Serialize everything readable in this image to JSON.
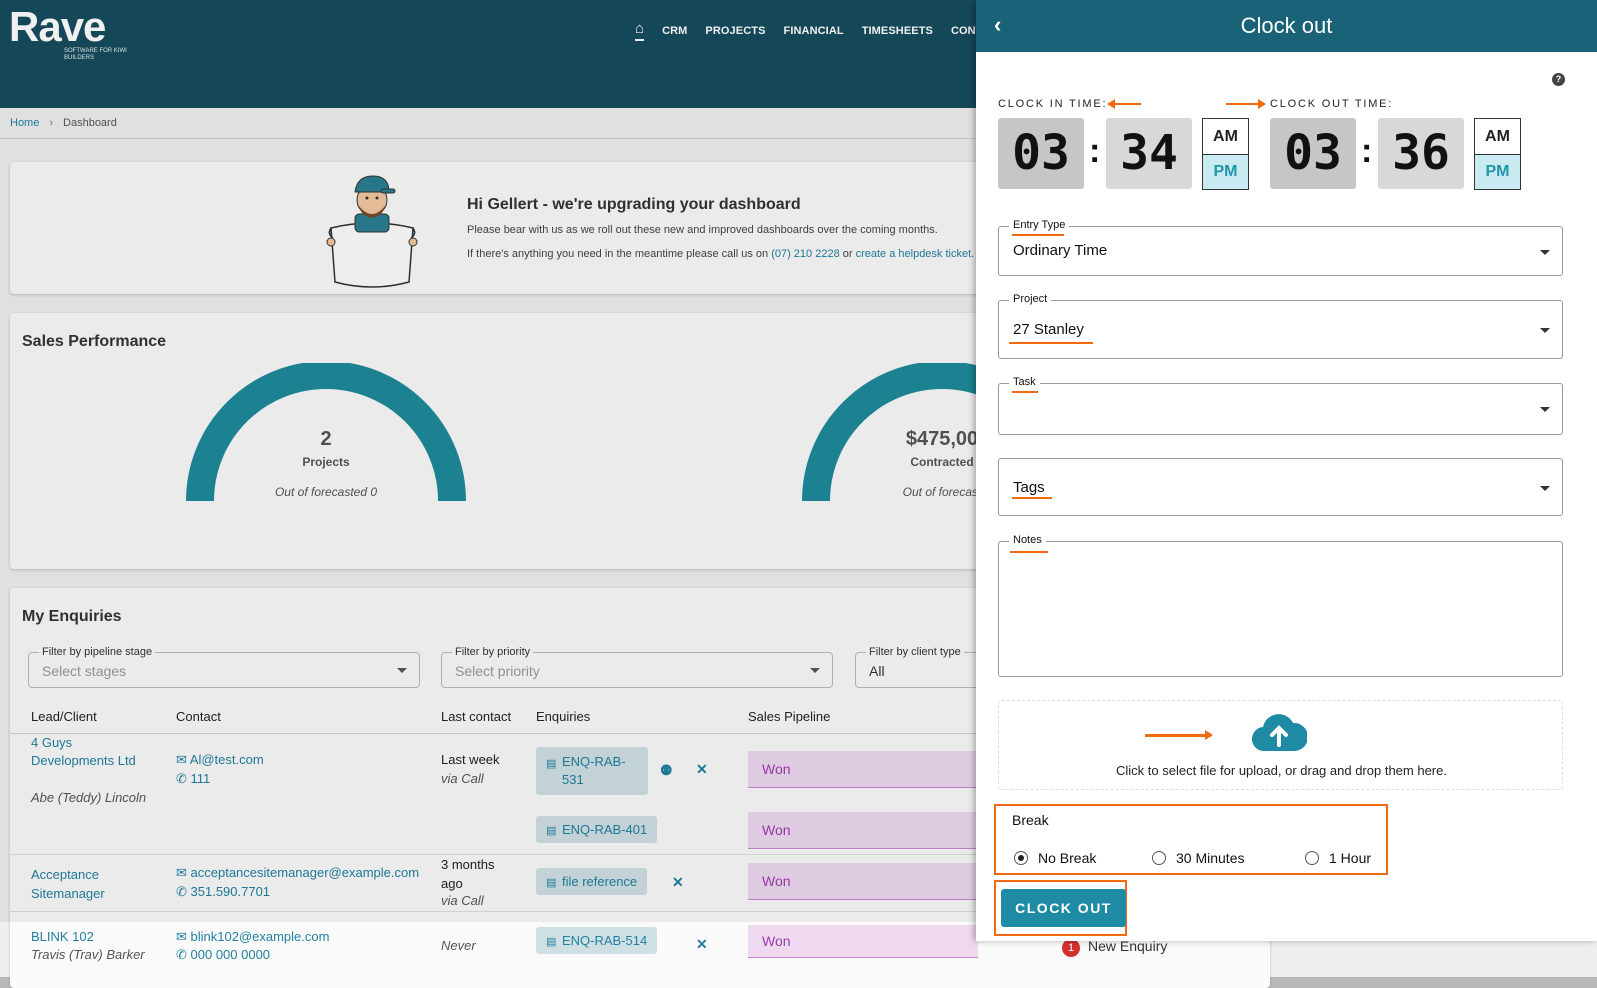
{
  "app": {
    "logo_main": "Rave",
    "logo_sub": "SOFTWARE FOR KIWI BUILDERS",
    "nav": [
      "CRM",
      "PROJECTS",
      "FINANCIAL",
      "TIMESHEETS",
      "CONT"
    ],
    "breadcrumb": {
      "home": "Home",
      "current": "Dashboard"
    },
    "welcome": {
      "title": "Hi Gellert - we're upgrading your dashboard",
      "line1": "Please bear with us as we roll out these new and improved dashboards over the coming months.",
      "line2_prefix": "If there's anything you need in the meantime please call us on",
      "phone": "(07) 210 2228",
      "or": "or",
      "ticket": "create a helpdesk ticket."
    },
    "sales": {
      "title": "Sales Performance",
      "gauge1": {
        "value": "2",
        "label": "Projects",
        "sub": "Out of forecasted 0"
      },
      "gauge2": {
        "value": "$475,00",
        "label": "Contracted",
        "sub": "Out of forecast"
      },
      "accent": "#1e8a9a"
    },
    "enquiries": {
      "title": "My Enquiries",
      "filters": [
        {
          "label": "Filter by pipeline stage",
          "placeholder": "Select stages"
        },
        {
          "label": "Filter by priority",
          "placeholder": "Select priority"
        },
        {
          "label": "Filter by client type",
          "value": "All"
        }
      ],
      "headers": [
        "Lead/Client",
        "Contact",
        "Last contact",
        "Enquiries",
        "Sales Pipeline"
      ],
      "rows": [
        {
          "lead": "4 Guys Developments Ltd",
          "person": "Abe (Teddy) Lincoln",
          "email": "Al@test.com",
          "phone": "111",
          "last": "Last week",
          "via": "via Call",
          "enq1": "ENQ-RAB-531",
          "enq2": "ENQ-RAB-401",
          "stage1": "Won",
          "stage2": "Won"
        },
        {
          "lead": "Acceptance Sitemanager",
          "email": "acceptancesitemanager@example.com",
          "phone": "351.590.7701",
          "last": "3 months ago",
          "via": "via Call",
          "enq1": "file reference",
          "stage1": "Won"
        },
        {
          "lead": "BLINK 102",
          "person": "Travis (Trav) Barker",
          "email": "blink102@example.com",
          "phone": "000 000 0000",
          "last": "Never",
          "enq1": "ENQ-RAB-514",
          "stage1": "Won",
          "status_count": "1",
          "status": "New Enquiry"
        }
      ]
    }
  },
  "drawer": {
    "title": "Clock out",
    "clock_in_label": "CLOCK IN TIME:",
    "clock_out_label": "CLOCK OUT TIME:",
    "clock_in": {
      "hour": "03",
      "minute": "34",
      "am": "AM",
      "pm": "PM",
      "selected": "PM"
    },
    "clock_out": {
      "hour": "03",
      "minute": "36",
      "am": "AM",
      "pm": "PM",
      "selected": "PM"
    },
    "entry_type": {
      "label": "Entry Type",
      "value": "Ordinary Time"
    },
    "project": {
      "label": "Project",
      "value": "27 Stanley"
    },
    "task": {
      "label": "Task",
      "value": ""
    },
    "tags": {
      "label": "",
      "value": "Tags"
    },
    "notes": {
      "label": "Notes",
      "value": ""
    },
    "upload_text": "Click to select file for upload, or drag and drop them here.",
    "break": {
      "label": "Break",
      "options": [
        "No Break",
        "30 Minutes",
        "1 Hour"
      ],
      "selected": "No Break"
    },
    "submit": "CLOCK OUT",
    "header_color": "#1a6278",
    "highlight_color": "#f06a12"
  }
}
